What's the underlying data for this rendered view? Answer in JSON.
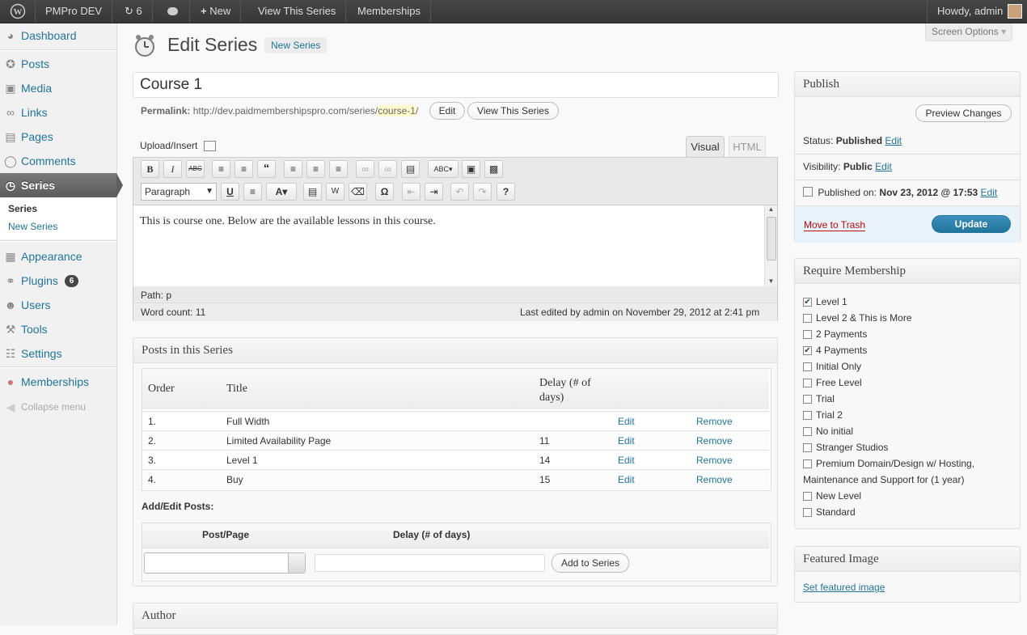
{
  "adminbar": {
    "site_name": "PMPro DEV",
    "updates_count": "6",
    "new_label": "New",
    "view_series": "View This Series",
    "memberships": "Memberships",
    "howdy": "Howdy, admin"
  },
  "screen_options": "Screen Options",
  "sidebar": {
    "items": [
      {
        "label": "Dashboard",
        "icon": "dashboard-icon"
      },
      {
        "label": "Posts",
        "icon": "pin-icon"
      },
      {
        "label": "Media",
        "icon": "media-icon"
      },
      {
        "label": "Links",
        "icon": "link-icon"
      },
      {
        "label": "Pages",
        "icon": "page-icon"
      },
      {
        "label": "Comments",
        "icon": "comment-icon"
      },
      {
        "label": "Series",
        "icon": "clock-icon"
      },
      {
        "label": "Appearance",
        "icon": "appearance-icon"
      },
      {
        "label": "Plugins",
        "icon": "plug-icon",
        "badge": "6"
      },
      {
        "label": "Users",
        "icon": "users-icon"
      },
      {
        "label": "Tools",
        "icon": "tools-icon"
      },
      {
        "label": "Settings",
        "icon": "settings-icon"
      },
      {
        "label": "Memberships",
        "icon": "members-icon"
      }
    ],
    "submenu": [
      "Series",
      "New Series"
    ],
    "collapse": "Collapse menu"
  },
  "page": {
    "title": "Edit Series",
    "add_new": "New Series"
  },
  "post": {
    "title_value": "Course 1",
    "permalink_label": "Permalink:",
    "permalink_base": "http://dev.paidmembershipspro.com/series/",
    "permalink_slug": "course-1",
    "permalink_end": "/",
    "edit_btn": "Edit",
    "view_btn": "View This Series"
  },
  "editor": {
    "upload_insert": "Upload/Insert",
    "tab_visual": "Visual",
    "tab_html": "HTML",
    "format_select": "Paragraph",
    "content": "This is course one. Below are the available lessons in this course.",
    "path": "Path: p",
    "word_count": "Word count: 11",
    "last_edited": "Last edited by admin on November 29, 2012 at 2:41 pm"
  },
  "series_box": {
    "title": "Posts in this Series",
    "headers": {
      "order": "Order",
      "title": "Title",
      "delay": "Delay (# of days)"
    },
    "rows": [
      {
        "order": "1.",
        "title": "Full Width",
        "delay": "",
        "edit": "Edit",
        "remove": "Remove"
      },
      {
        "order": "2.",
        "title": "Limited Availability Page",
        "delay": "11",
        "edit": "Edit",
        "remove": "Remove"
      },
      {
        "order": "3.",
        "title": "Level 1",
        "delay": "14",
        "edit": "Edit",
        "remove": "Remove"
      },
      {
        "order": "4.",
        "title": "Buy",
        "delay": "15",
        "edit": "Edit",
        "remove": "Remove"
      }
    ],
    "add_edit_label": "Add/Edit Posts:",
    "col_post": "Post/Page",
    "col_delay": "Delay (# of days)",
    "add_btn": "Add to Series"
  },
  "author_box": {
    "title": "Author"
  },
  "publish": {
    "title": "Publish",
    "preview_btn": "Preview Changes",
    "status_label": "Status:",
    "status_value": "Published",
    "visibility_label": "Visibility:",
    "visibility_value": "Public",
    "published_label": "Published on:",
    "published_value": "Nov 23, 2012 @ 17:53",
    "edit": "Edit",
    "trash": "Move to Trash",
    "update": "Update"
  },
  "membership": {
    "title": "Require Membership",
    "levels": [
      {
        "label": "Level 1",
        "checked": true
      },
      {
        "label": "Level 2 & This is More",
        "checked": false
      },
      {
        "label": "2 Payments",
        "checked": false
      },
      {
        "label": "4 Payments",
        "checked": true
      },
      {
        "label": "Initial Only",
        "checked": false
      },
      {
        "label": "Free Level",
        "checked": false
      },
      {
        "label": "Trial",
        "checked": false
      },
      {
        "label": "Trial 2",
        "checked": false
      },
      {
        "label": "No initial",
        "checked": false
      },
      {
        "label": "Stranger Studios",
        "checked": false
      },
      {
        "label": "Premium Domain/Design w/ Hosting,",
        "label2": "Maintenance and Support for (1 year)",
        "checked": false
      },
      {
        "label": "New Level",
        "checked": false
      },
      {
        "label": "Standard",
        "checked": false
      }
    ]
  },
  "featured": {
    "title": "Featured Image",
    "link": "Set featured image"
  },
  "colors": {
    "link": "#21759b",
    "update": "#21759b",
    "trash": "#bc0b0b",
    "highlight": "#fffbcc"
  }
}
